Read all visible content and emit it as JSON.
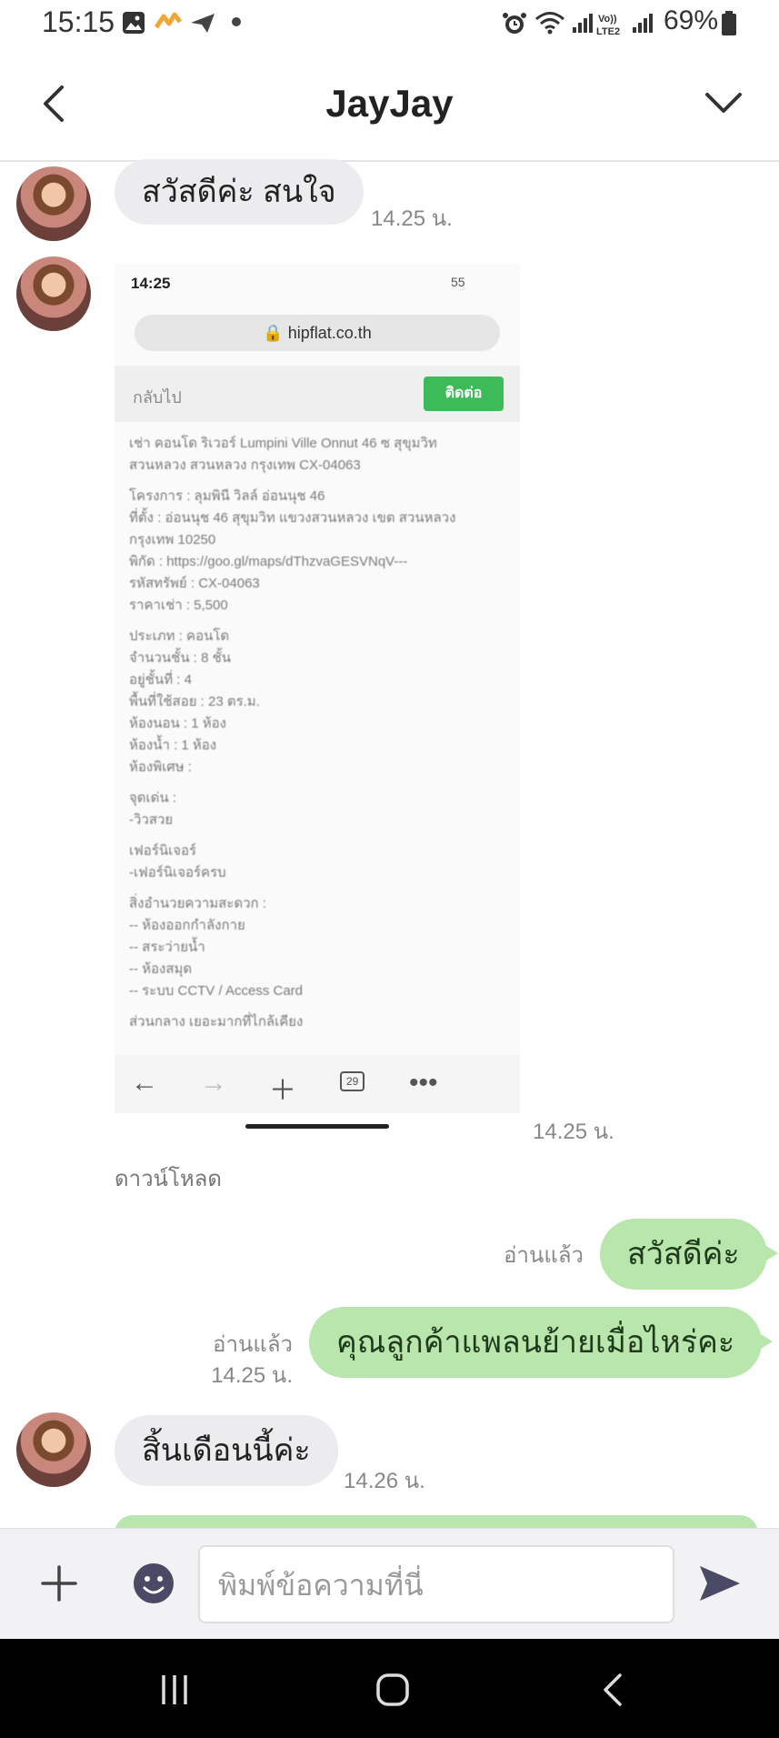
{
  "status_bar": {
    "time": "15:15",
    "battery": "69%"
  },
  "header": {
    "title": "JayJay"
  },
  "messages": {
    "m1": {
      "text": "สวัสดีค่ะ สนใจ",
      "time": "14.25 น."
    },
    "m2": {
      "time": "14.25 น.",
      "download_label": "ดาวน์โหลด"
    },
    "m3": {
      "text": "สวัสดีค่ะ",
      "read": "อ่านแล้ว"
    },
    "m4": {
      "text": "คุณลูกค้าแพลนย้ายเมื่อไหร่คะ",
      "read": "อ่านแล้ว",
      "time": "14.25 น."
    },
    "m5": {
      "text": "สิ้นเดือนนี้ค่ะ",
      "time": "14.26 น."
    }
  },
  "shared_image": {
    "status_time": "14:25",
    "status_right": "55",
    "url": "hipflat.co.th",
    "back_label": "กลับไป",
    "button_label": "ติดต่อ",
    "lines": [
      "เช่า คอนโด ริเวอร์ Lumpini Ville Onnut 46 ซ สุขุมวิท",
      "สวนหลวง สวนหลวง กรุงเทพ CX-04063",
      "",
      "โครงการ : ลุมพินี วิลล์ อ่อนนุช 46",
      "ที่ตั้ง : อ่อนนุช 46 สุขุมวิท แขวงสวนหลวง เขต สวนหลวง",
      "กรุงเทพ 10250",
      "พิกัด : https://goo.gl/maps/dThzvaGESVNqV---",
      "รหัสทรัพย์ : CX-04063",
      "ราคาเช่า : 5,500",
      "",
      "ประเภท : คอนโด",
      "จำนวนชั้น : 8 ชั้น",
      "อยู่ชั้นที่ : 4",
      "พื้นที่ใช้สอย : 23 ตร.ม.",
      "ห้องนอน : 1 ห้อง",
      "ห้องน้ำ : 1 ห้อง",
      "ห้องพิเศษ :",
      "",
      "จุดเด่น :",
      "-วิวสวย",
      "",
      "เฟอร์นิเจอร์",
      "-เฟอร์นิเจอร์ครบ",
      "",
      "สิ่งอำนวยความสะดวก :",
      "-- ห้องออกกำลังกาย",
      "-- สระว่ายน้ำ",
      "-- ห้องสมุด",
      "-- ระบบ CCTV / Access Card",
      "",
      "ส่วนกลาง เยอะมากที่ไกล้เคียง"
    ],
    "tabs_count": "29"
  },
  "input": {
    "placeholder": "พิมพ์ข้อความที่นี่"
  }
}
